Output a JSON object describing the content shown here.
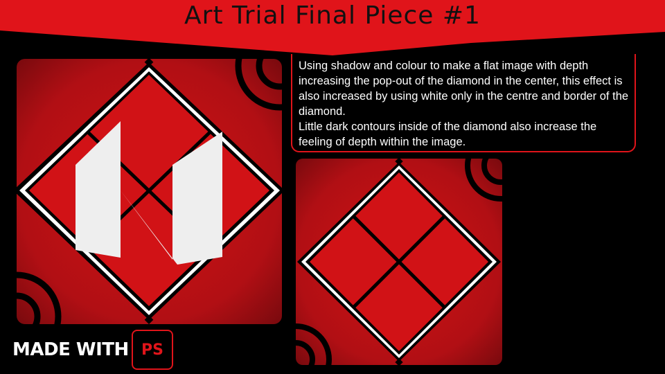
{
  "slide": {
    "title": "Art Trial Final Piece #1",
    "description": [
      "Using shadow and colour to make a flat image with depth increasing the pop-out of the diamond in the center, this effect is also increased by using white only in the centre and border of the diamond.",
      "Little dark contours inside of the diamond also increase the feeling of depth within the image."
    ],
    "made_with": "MADE WITH",
    "ps_badge": "PS"
  },
  "colors": {
    "banner_red": "#e0141a",
    "art_red": "#d11216",
    "art_dark_red": "#7a0a0e",
    "text_white": "#ffffff"
  },
  "icons": [
    "photoshop-badge-icon",
    "letter-n-logo-icon",
    "diamond-emblem-icon"
  ]
}
